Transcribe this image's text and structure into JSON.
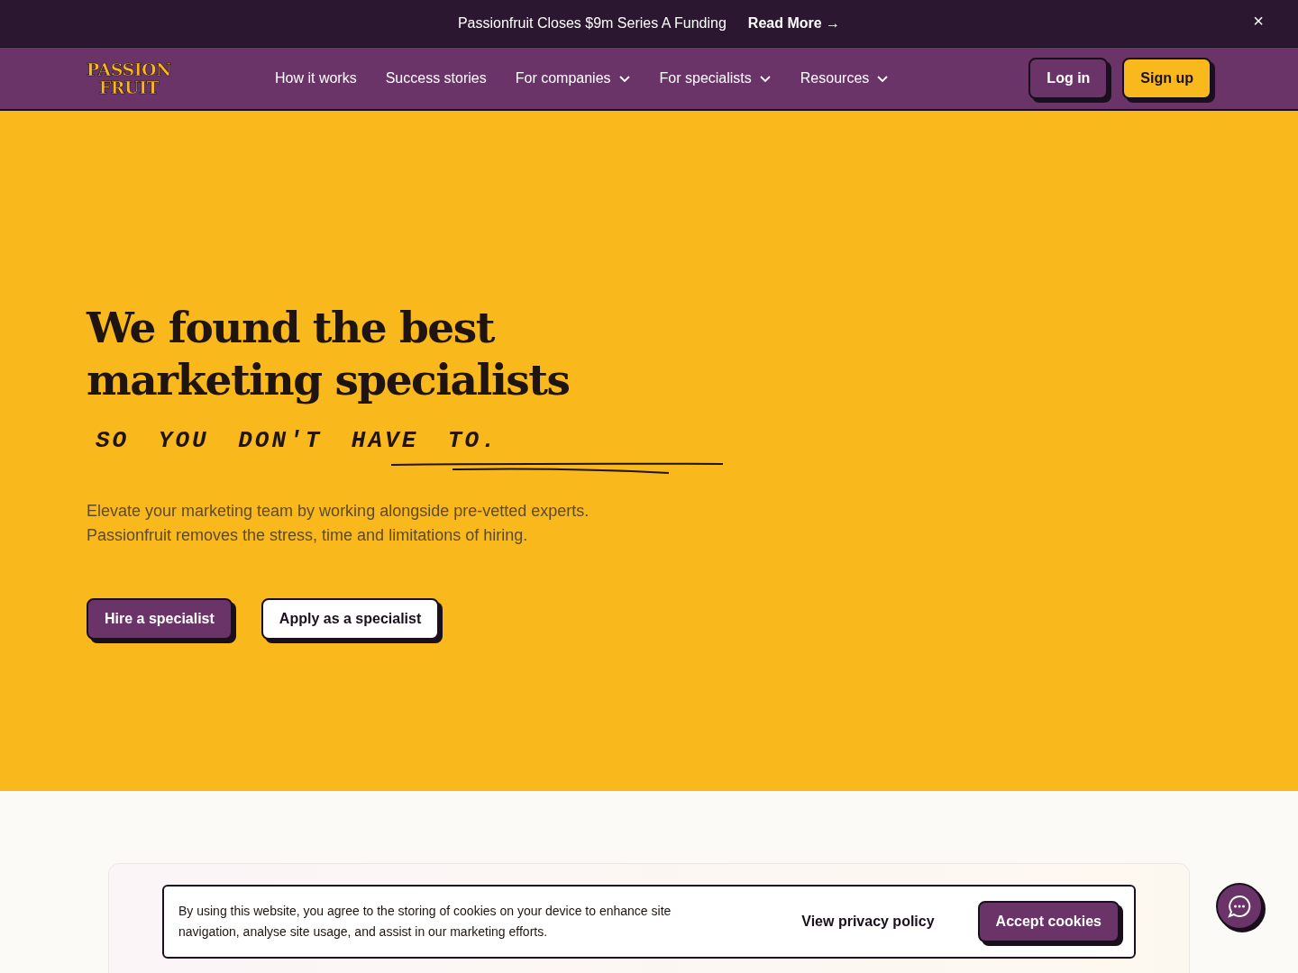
{
  "announcement": {
    "text": "Passionfruit Closes $9m Series A Funding",
    "link": "Read More →",
    "close": "×"
  },
  "navbar": {
    "logo": [
      "PASSION",
      "FRUIT"
    ],
    "items": [
      {
        "label": "How it works",
        "kind": "link"
      },
      {
        "label": "Success stories",
        "kind": "link"
      },
      {
        "label": "For companies",
        "kind": "dropdown"
      },
      {
        "label": "For specialists",
        "kind": "dropdown"
      },
      {
        "label": "Resources",
        "kind": "dropdown"
      }
    ],
    "buttons": [
      {
        "label": "Log in",
        "kind": "dark"
      },
      {
        "label": "Sign up",
        "kind": "yellow"
      }
    ]
  },
  "hero": {
    "title": "We found the best marketing specialists",
    "handwritten": "SO YOU DON'T HAVE TO.",
    "subtitle": "Elevate your marketing team by working alongside pre-vetted experts. Passionfruit removes the stress, time and limitations of hiring.",
    "buttons": [
      {
        "label": "Hire a specialist",
        "kind": "dark"
      },
      {
        "label": "Apply as a specialist",
        "kind": "light"
      }
    ]
  },
  "cookie_banner": {
    "text": "By using this website, you agree to the storing of cookies on your device to enhance site navigation, analyse site usage, and assist in our marketing efforts.",
    "policy_link": "View privacy policy",
    "accept": "Accept cookies"
  }
}
